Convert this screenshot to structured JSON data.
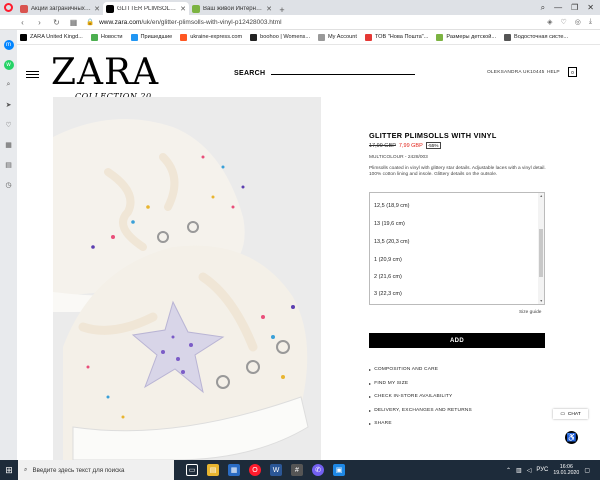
{
  "browser": {
    "tabs": [
      {
        "label": "Акции заграничных магаз",
        "active": false,
        "favicon_color": "#d9534f"
      },
      {
        "label": "GLITTER PLIMSOLLS WITH",
        "active": true,
        "favicon_color": "#000000"
      },
      {
        "label": "Ваш живой Интернет-Банк",
        "active": false,
        "favicon_color": "#7cb342"
      }
    ],
    "url_host": "www.zara.com",
    "url_path": "/uk/en/glitter-plimsolls-with-vinyl-p12428003.html",
    "bookmarks": [
      {
        "label": "ZARA United Kingd...",
        "color": "#000000"
      },
      {
        "label": "Новости",
        "color": "#4caf50"
      },
      {
        "label": "Пришедшие",
        "color": "#2196f3"
      },
      {
        "label": "ukraine-express.com",
        "color": "#ff5722"
      },
      {
        "label": "boohoo | Womens...",
        "color": "#222222"
      },
      {
        "label": "My Account",
        "color": "#999999"
      },
      {
        "label": "ТОВ \"Нова Пошта\"...",
        "color": "#e53935"
      },
      {
        "label": "Размеры детской...",
        "color": "#7cb342"
      },
      {
        "label": "Водосточная систе...",
        "color": "#555555"
      }
    ]
  },
  "header": {
    "logo": "ZARA",
    "collection": "COLLECTION 20",
    "search_label": "SEARCH",
    "account": "OLEKSANDRA UK10445",
    "help": "HELP",
    "bag_count": "0"
  },
  "product": {
    "title": "GLITTER PLIMSOLLS WITH VINYL",
    "old_price": "17,99 GBP",
    "new_price": "7,99 GBP",
    "discount": "-55%",
    "color_ref": "MULTICOLOUR - 2428/003",
    "description": "Plimsolls coated in vinyl with glittery star details. Adjustable laces with a vinyl detail. 100% cotton lining and insole. Glittery details on the outsole.",
    "sizes": [
      "12,5 (18,9 cm)",
      "13 (19,6 cm)",
      "13,5 (20,3 cm)",
      "1 (20,9 cm)",
      "2 (21,6 cm)",
      "3 (22,3 cm)"
    ],
    "size_guide": "Size guide",
    "add_button": "ADD",
    "links": [
      "COMPOSITION AND CARE",
      "FIND MY SIZE",
      "CHECK IN-STORE AVAILABILITY",
      "DELIVERY, EXCHANGES AND RETURNS",
      "SHARE"
    ]
  },
  "widgets": {
    "chat": "CHAT"
  },
  "taskbar": {
    "search_placeholder": "Введите здесь текст для поиска",
    "lang": "РУС",
    "time": "16:06",
    "date": "19.01.2020"
  }
}
